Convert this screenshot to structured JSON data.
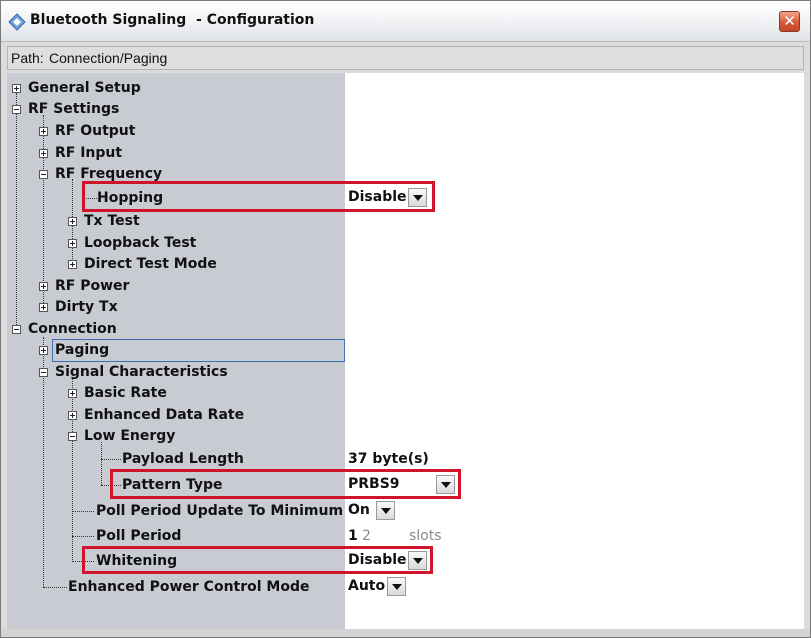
{
  "window": {
    "title": "Bluetooth Signaling  - Configuration",
    "close_glyph": "✕",
    "icons": {
      "app": "bluetooth-diamond-icon",
      "close": "close-icon"
    }
  },
  "path_bar": {
    "label": "Path:",
    "value": "Connection/Paging"
  },
  "tree": {
    "general_setup": "General Setup",
    "rf_settings": "RF Settings",
    "rf_output": "RF Output",
    "rf_input": "RF Input",
    "rf_frequency": "RF Frequency",
    "hopping": "Hopping",
    "tx_test": "Tx Test",
    "loopback_test": "Loopback Test",
    "direct_test_mode": "Direct Test Mode",
    "rf_power": "RF Power",
    "dirty_tx": "Dirty Tx",
    "connection": "Connection",
    "paging": "Paging",
    "signal_characteristics": "Signal Characteristics",
    "basic_rate": "Basic Rate",
    "enhanced_data_rate": "Enhanced Data Rate",
    "low_energy": "Low Energy",
    "payload_length": "Payload Length",
    "pattern_type": "Pattern Type",
    "poll_period_update": "Poll Period Update To Minimum",
    "poll_period": "Poll Period",
    "whitening": "Whitening",
    "enhanced_power_control": "Enhanced Power Control Mode"
  },
  "values": {
    "hopping": "Disable",
    "payload_length": "37 byte(s)",
    "pattern_type": "PRBS9",
    "poll_period_update": "On",
    "poll_period_active": "1",
    "poll_period_alt": "2",
    "poll_period_unit": "slots",
    "whitening": "Disable",
    "enhanced_power_control": "Auto"
  },
  "colors": {
    "highlight_box": "#d0142a",
    "selection": "#3c6fb4",
    "tree_bg": "#c8cbd2"
  }
}
